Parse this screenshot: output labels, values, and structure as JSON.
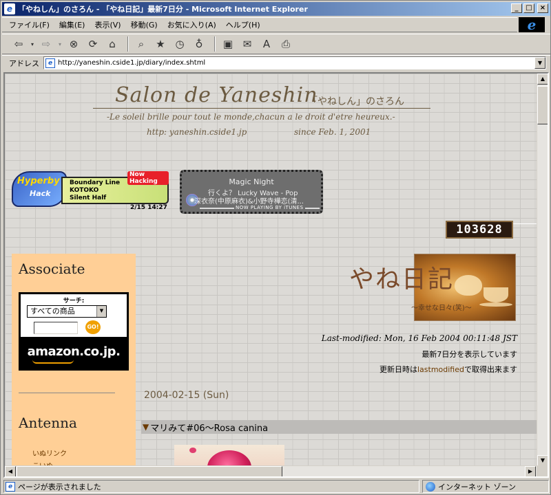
{
  "window": {
    "title": "「やねしん」のさろん - 「やね日記」最新7日分 - Microsoft Internet Explorer",
    "controls": {
      "minimize": "_",
      "maximize": "□",
      "close": "×"
    }
  },
  "menu": {
    "items": [
      "ファイル(F)",
      "編集(E)",
      "表示(V)",
      "移動(G)",
      "お気に入り(A)",
      "ヘルプ(H)"
    ]
  },
  "toolbar": {
    "buttons": [
      "back-icon",
      "forward-icon",
      "stop-icon",
      "refresh-icon",
      "home-icon",
      "search-icon",
      "favorites-icon",
      "history-icon",
      "channels-icon",
      "fullscreen-icon",
      "mail-icon",
      "font-icon",
      "print-icon"
    ]
  },
  "address": {
    "label": "アドレス",
    "url": "http://yaneshin.cside1.jp/diary/index.shtml"
  },
  "header": {
    "title": "Salon de Yaneshin",
    "subtitle": "「やねしん」のさろん",
    "motto": "-Le soleil brille pour tout le monde,chacun a le droit d'etre heureux.-",
    "url": "http: yaneshin.cside1.jp",
    "since": "since Feb. 1, 2001"
  },
  "hyperby": {
    "logo": "Hyperby",
    "logo_sub": "Hack",
    "now": "Now Hacking",
    "lines": [
      "Boundary Line",
      "KOTOKO",
      "Silent Half"
    ],
    "time": "2/15 14:27"
  },
  "magic_night": {
    "title": "Magic Night",
    "song": "行くよ？ Lucky Wave - Pop",
    "artist": "深衣奈(中原麻衣)&小野寺樺恋(清...",
    "now_playing": "NOW PLAYING BY iTUNES"
  },
  "counter": {
    "value": "103628"
  },
  "sidebar": {
    "associate_heading": "Associate",
    "search_label": "サーチ:",
    "select_value": "すべての商品",
    "go_label": "GO!",
    "amazon_logo": "amazon.co.jp.",
    "antenna_heading": "Antenna",
    "links": [
      "いぬリンク",
      "こいぬ"
    ]
  },
  "diary": {
    "title": "やね日記",
    "tagline": "〜幸せな日々(笑)〜",
    "last_modified": "Last-modified: Mon, 16 Feb 2004 00:11:48 JST",
    "showing": "最新7日分を表示しています",
    "updated_prefix": "更新日時は",
    "updated_link": "lastmodified",
    "updated_suffix": "で取得出来ます"
  },
  "entry": {
    "date": "2004-02-15 (Sun)",
    "marker": "▼",
    "title": "マリみて#06〜Rosa canina"
  },
  "status": {
    "text": "ページが表示されました",
    "zone": "インターネット ゾーン"
  },
  "colors": {
    "title_bar_start": "#0a246a",
    "sidebar_bg": "#ffcf96",
    "header_text": "#6b5a40"
  }
}
